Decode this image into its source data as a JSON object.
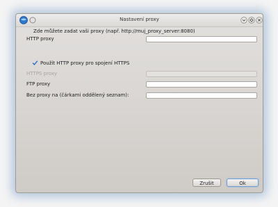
{
  "window": {
    "title": "Nastavení proxy"
  },
  "form": {
    "intro": "Zde můžete zadat vaši proxy (např. http://muj_proxy_server:8080)",
    "http_proxy_label": "HTTP proxy",
    "http_proxy_value": "",
    "use_http_for_https_label": "Použít HTTP proxy pro spojení HTTPS",
    "use_http_for_https_checked": true,
    "https_proxy_label": "HTTPS proxy",
    "https_proxy_value": "",
    "ftp_proxy_label": "FTP proxy",
    "ftp_proxy_value": "",
    "no_proxy_label": "Bez proxy na (čárkami oddělený seznam):",
    "no_proxy_value": ""
  },
  "buttons": {
    "cancel": "Zrušit",
    "ok": "Ok"
  },
  "colors": {
    "window_glow": "#5f8cbe",
    "checkbox_mark": "#2a6fc0"
  },
  "icons": {
    "app": "app-globe-icon",
    "pin": "pin-icon",
    "minimize": "minimize-icon",
    "maximize": "maximize-icon",
    "close": "close-icon",
    "check": "checkmark-icon"
  }
}
